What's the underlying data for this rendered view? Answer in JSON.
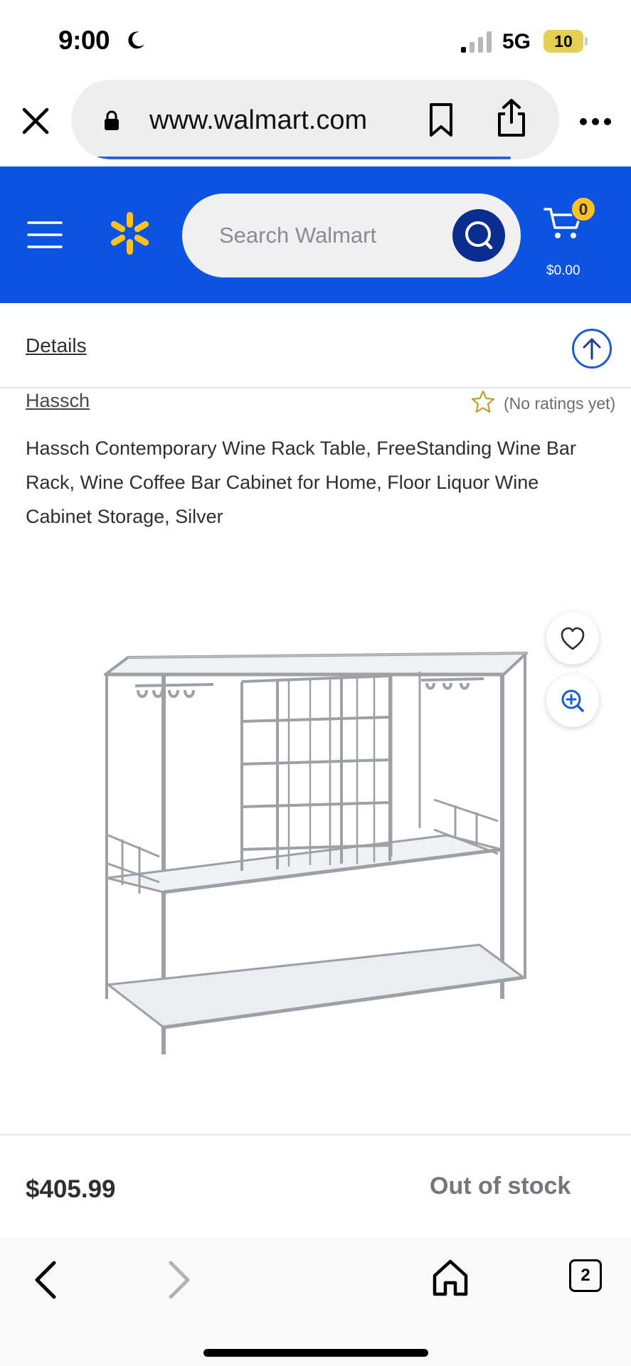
{
  "status_bar": {
    "time": "9:00",
    "network": "5G",
    "battery": "10",
    "icons": [
      "moon-icon",
      "signal-icon",
      "battery-icon"
    ]
  },
  "browser": {
    "url": "www.walmart.com",
    "icons": [
      "close-icon",
      "lock-icon",
      "bookmark-icon",
      "share-icon",
      "more-icon"
    ]
  },
  "header": {
    "search_placeholder": "Search Walmart",
    "cart_count": "0",
    "cart_total": "$0.00",
    "brand_color": "#0b53e0",
    "spark_color": "#ffc220",
    "icons": [
      "menu-icon",
      "walmart-spark-icon",
      "search-icon",
      "cart-icon"
    ]
  },
  "details_bar": {
    "label": "Details",
    "icons": [
      "arrow-up-icon"
    ]
  },
  "product": {
    "brand": "Hassch",
    "rating_text": "(No ratings yet)",
    "title": "Hassch Contemporary Wine Rack Table, FreeStanding Wine Bar Rack, Wine Coffee Bar Cabinet for Home, Floor Liquor Wine Cabinet Storage, Silver",
    "price": "$405.99",
    "stock_status": "Out of stock",
    "icons": [
      "star-icon",
      "heart-icon",
      "zoom-in-icon"
    ]
  },
  "bottom_nav": {
    "tab_count": "2",
    "icons": [
      "back-icon",
      "forward-icon",
      "home-icon",
      "tabs-icon"
    ]
  }
}
